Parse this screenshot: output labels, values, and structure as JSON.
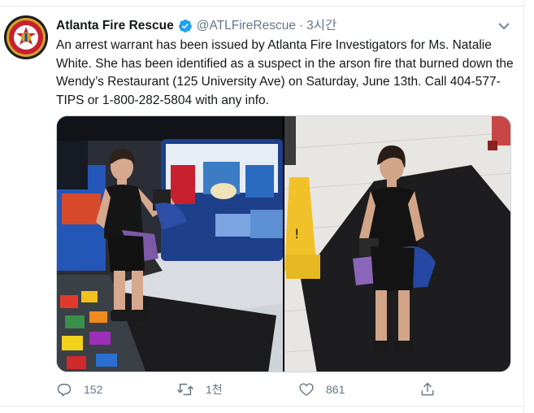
{
  "tweet": {
    "display_name": "Atlanta Fire Rescue",
    "handle": "@ATLFireRescue",
    "separator": "·",
    "timestamp": "3시간",
    "text": "An arrest warrant has been issued by Atlanta Fire Investigators for Ms. Natalie White. She has been identified as a suspect in the arson fire that burned down the Wendy’s Restaurant (125 University Ave) on Saturday, June 13th. Call 404-577-TIPS or 1-800-282-5804 with any info."
  },
  "media": {
    "images": [
      {
        "name": "surveillance-photo-store-aisle"
      },
      {
        "name": "surveillance-photo-entrance-mat"
      }
    ]
  },
  "actions": {
    "reply_count": "152",
    "retweet_count": "1천",
    "like_count": "861"
  },
  "icons": {
    "avatar": "atlanta-fire-rescue-logo-icon",
    "verified": "verified-badge-icon",
    "caret": "chevron-down-icon",
    "reply": "reply-icon",
    "retweet": "retweet-icon",
    "like": "heart-icon",
    "share": "share-icon"
  },
  "colors": {
    "verified": "#1da1f2",
    "secondary_text": "#657786",
    "primary_text": "#14171a",
    "logo_red": "#c8202f",
    "logo_gold": "#d4a52a"
  }
}
